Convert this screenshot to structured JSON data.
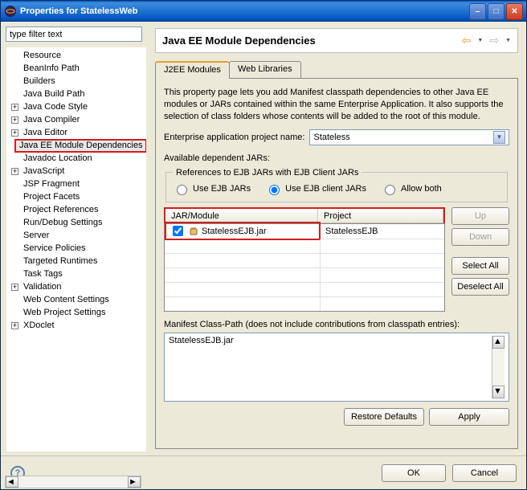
{
  "window": {
    "title": "Properties for StatelessWeb"
  },
  "filter": {
    "placeholder": "type filter text"
  },
  "tree": {
    "items": [
      {
        "label": "Resource",
        "expand": ""
      },
      {
        "label": "BeanInfo Path",
        "expand": ""
      },
      {
        "label": "Builders",
        "expand": ""
      },
      {
        "label": "Java Build Path",
        "expand": ""
      },
      {
        "label": "Java Code Style",
        "expand": "+"
      },
      {
        "label": "Java Compiler",
        "expand": "+"
      },
      {
        "label": "Java Editor",
        "expand": "+"
      },
      {
        "label": "Java EE Module Dependencies",
        "expand": "",
        "selected": true
      },
      {
        "label": "Javadoc Location",
        "expand": ""
      },
      {
        "label": "JavaScript",
        "expand": "+"
      },
      {
        "label": "JSP Fragment",
        "expand": ""
      },
      {
        "label": "Project Facets",
        "expand": ""
      },
      {
        "label": "Project References",
        "expand": ""
      },
      {
        "label": "Run/Debug Settings",
        "expand": ""
      },
      {
        "label": "Server",
        "expand": ""
      },
      {
        "label": "Service Policies",
        "expand": ""
      },
      {
        "label": "Targeted Runtimes",
        "expand": ""
      },
      {
        "label": "Task Tags",
        "expand": ""
      },
      {
        "label": "Validation",
        "expand": "+"
      },
      {
        "label": "Web Content Settings",
        "expand": ""
      },
      {
        "label": "Web Project Settings",
        "expand": ""
      },
      {
        "label": "XDoclet",
        "expand": "+"
      }
    ]
  },
  "banner": {
    "title": "Java EE Module Dependencies"
  },
  "tabs": {
    "active": "J2EE Modules",
    "other": "Web Libraries"
  },
  "page": {
    "desc": "This property page lets you add Manifest classpath dependencies to other Java EE modules or JARs contained within the same Enterprise Application. It also supports the selection of class folders whose contents will be added to the root of this module.",
    "ear_label": "Enterprise application project name:",
    "ear_value": "Stateless",
    "avail_label": "Available dependent JARs:",
    "group_title": "References to EJB JARs with EJB Client JARs",
    "radios": {
      "r1": "Use EJB JARs",
      "r2": "Use EJB client JARs",
      "r3": "Allow both"
    },
    "columns": {
      "jar": "JAR/Module",
      "project": "Project"
    },
    "rows": [
      {
        "checked": true,
        "jar": "StatelessEJB.jar",
        "project": "StatelessEJB"
      }
    ],
    "buttons": {
      "up": "Up",
      "down": "Down",
      "select_all": "Select All",
      "deselect_all": "Deselect All"
    },
    "manifest_label": "Manifest Class-Path (does not include contributions from classpath entries):",
    "manifest_value": "StatelessEJB.jar",
    "restore": "Restore Defaults",
    "apply": "Apply"
  },
  "footer": {
    "ok": "OK",
    "cancel": "Cancel"
  }
}
